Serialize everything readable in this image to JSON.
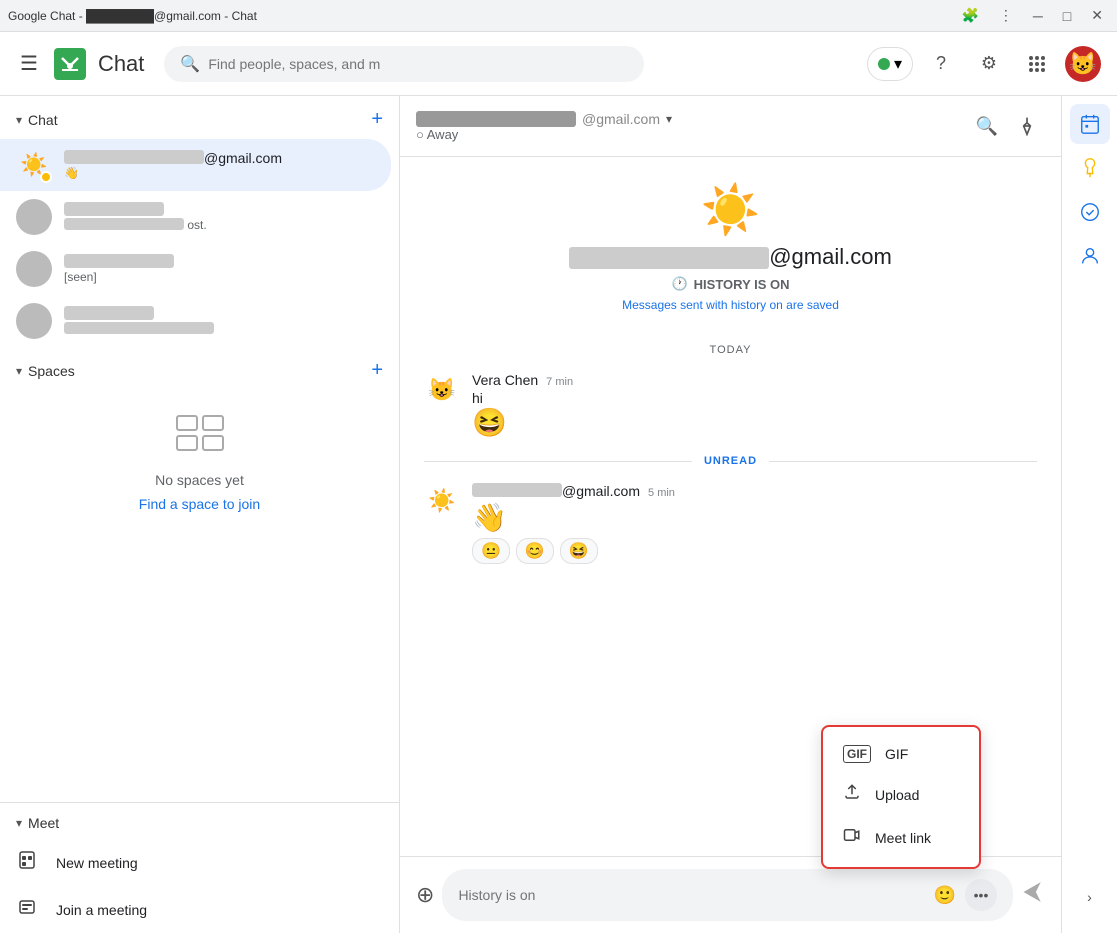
{
  "titlebar": {
    "title": "Google Chat - ████████@gmail.com - Chat",
    "minimize": "─",
    "maximize": "□",
    "close": "✕",
    "menu_icon": "⋮",
    "puzzle_icon": "🧩"
  },
  "header": {
    "app_name": "Chat",
    "logo_emoji": "💬",
    "search_placeholder": "Find people, spaces, and m",
    "status_dot_color": "#34a853",
    "help_icon": "?",
    "settings_icon": "⚙",
    "grid_icon": "⠿",
    "avatar_emoji": "😺"
  },
  "sidebar": {
    "chat_section": {
      "title": "Chat",
      "collapse_icon": "▾",
      "add_icon": "+"
    },
    "chat_items": [
      {
        "id": "user1",
        "name": "████████@gmail.com",
        "preview": "👋",
        "active": true,
        "avatar_type": "sun",
        "status": "away"
      },
      {
        "id": "user2",
        "name": "████████████",
        "preview": "████████ ost.",
        "active": false,
        "avatar_type": "photo"
      },
      {
        "id": "user3",
        "name": "████████████",
        "preview": "[seen]",
        "active": false,
        "avatar_type": "photo"
      },
      {
        "id": "user4",
        "name": "████████████",
        "preview": "████████████████",
        "active": false,
        "avatar_type": "photo"
      }
    ],
    "spaces_section": {
      "title": "Spaces",
      "collapse_icon": "▾",
      "add_icon": "+"
    },
    "no_spaces_icon": "▦",
    "no_spaces_text": "No spaces yet",
    "find_space_link": "Find a space to join",
    "meet_section": {
      "title": "Meet",
      "collapse_icon": "▾"
    },
    "meet_items": [
      {
        "id": "new-meeting",
        "icon": "⊞",
        "label": "New meeting"
      },
      {
        "id": "join-meeting",
        "icon": "⌨",
        "label": "Join a meeting"
      }
    ]
  },
  "chat_panel": {
    "header_name": "████████████@gmail.com",
    "header_status": "Away",
    "search_icon": "🔍",
    "pin_icon": "📌",
    "center_sun": "☀️",
    "center_email": "████████████████@gmail.com",
    "history_label": "HISTORY IS ON",
    "history_subtext": "Messages sent with history on are saved",
    "today_label": "TODAY",
    "messages": [
      {
        "id": "msg1",
        "sender": "Vera Chen",
        "time": "7 min",
        "avatar": "😺",
        "text": "hi",
        "emoji": "😆",
        "avatar_type": "emoji"
      }
    ],
    "unread_label": "UNREAD",
    "unread_message": {
      "sender": "████████@gmail.com",
      "time": "5 min",
      "avatar_type": "sun",
      "emoji": "👋",
      "reactions": [
        "😐",
        "😊",
        "😆"
      ]
    },
    "input_placeholder": "History is on",
    "send_icon": "▷"
  },
  "popup_menu": {
    "items": [
      {
        "id": "gif",
        "icon": "GIF",
        "label": "GIF"
      },
      {
        "id": "upload",
        "icon": "⬆",
        "label": "Upload"
      },
      {
        "id": "meet-link",
        "icon": "📹",
        "label": "Meet link"
      }
    ]
  },
  "right_sidebar": {
    "icons": [
      {
        "id": "calendar",
        "emoji": "📅",
        "active": true
      },
      {
        "id": "keep",
        "emoji": "💡",
        "active": false
      },
      {
        "id": "tasks",
        "emoji": "✔",
        "active": false
      },
      {
        "id": "account",
        "emoji": "👤",
        "active": false
      }
    ]
  }
}
